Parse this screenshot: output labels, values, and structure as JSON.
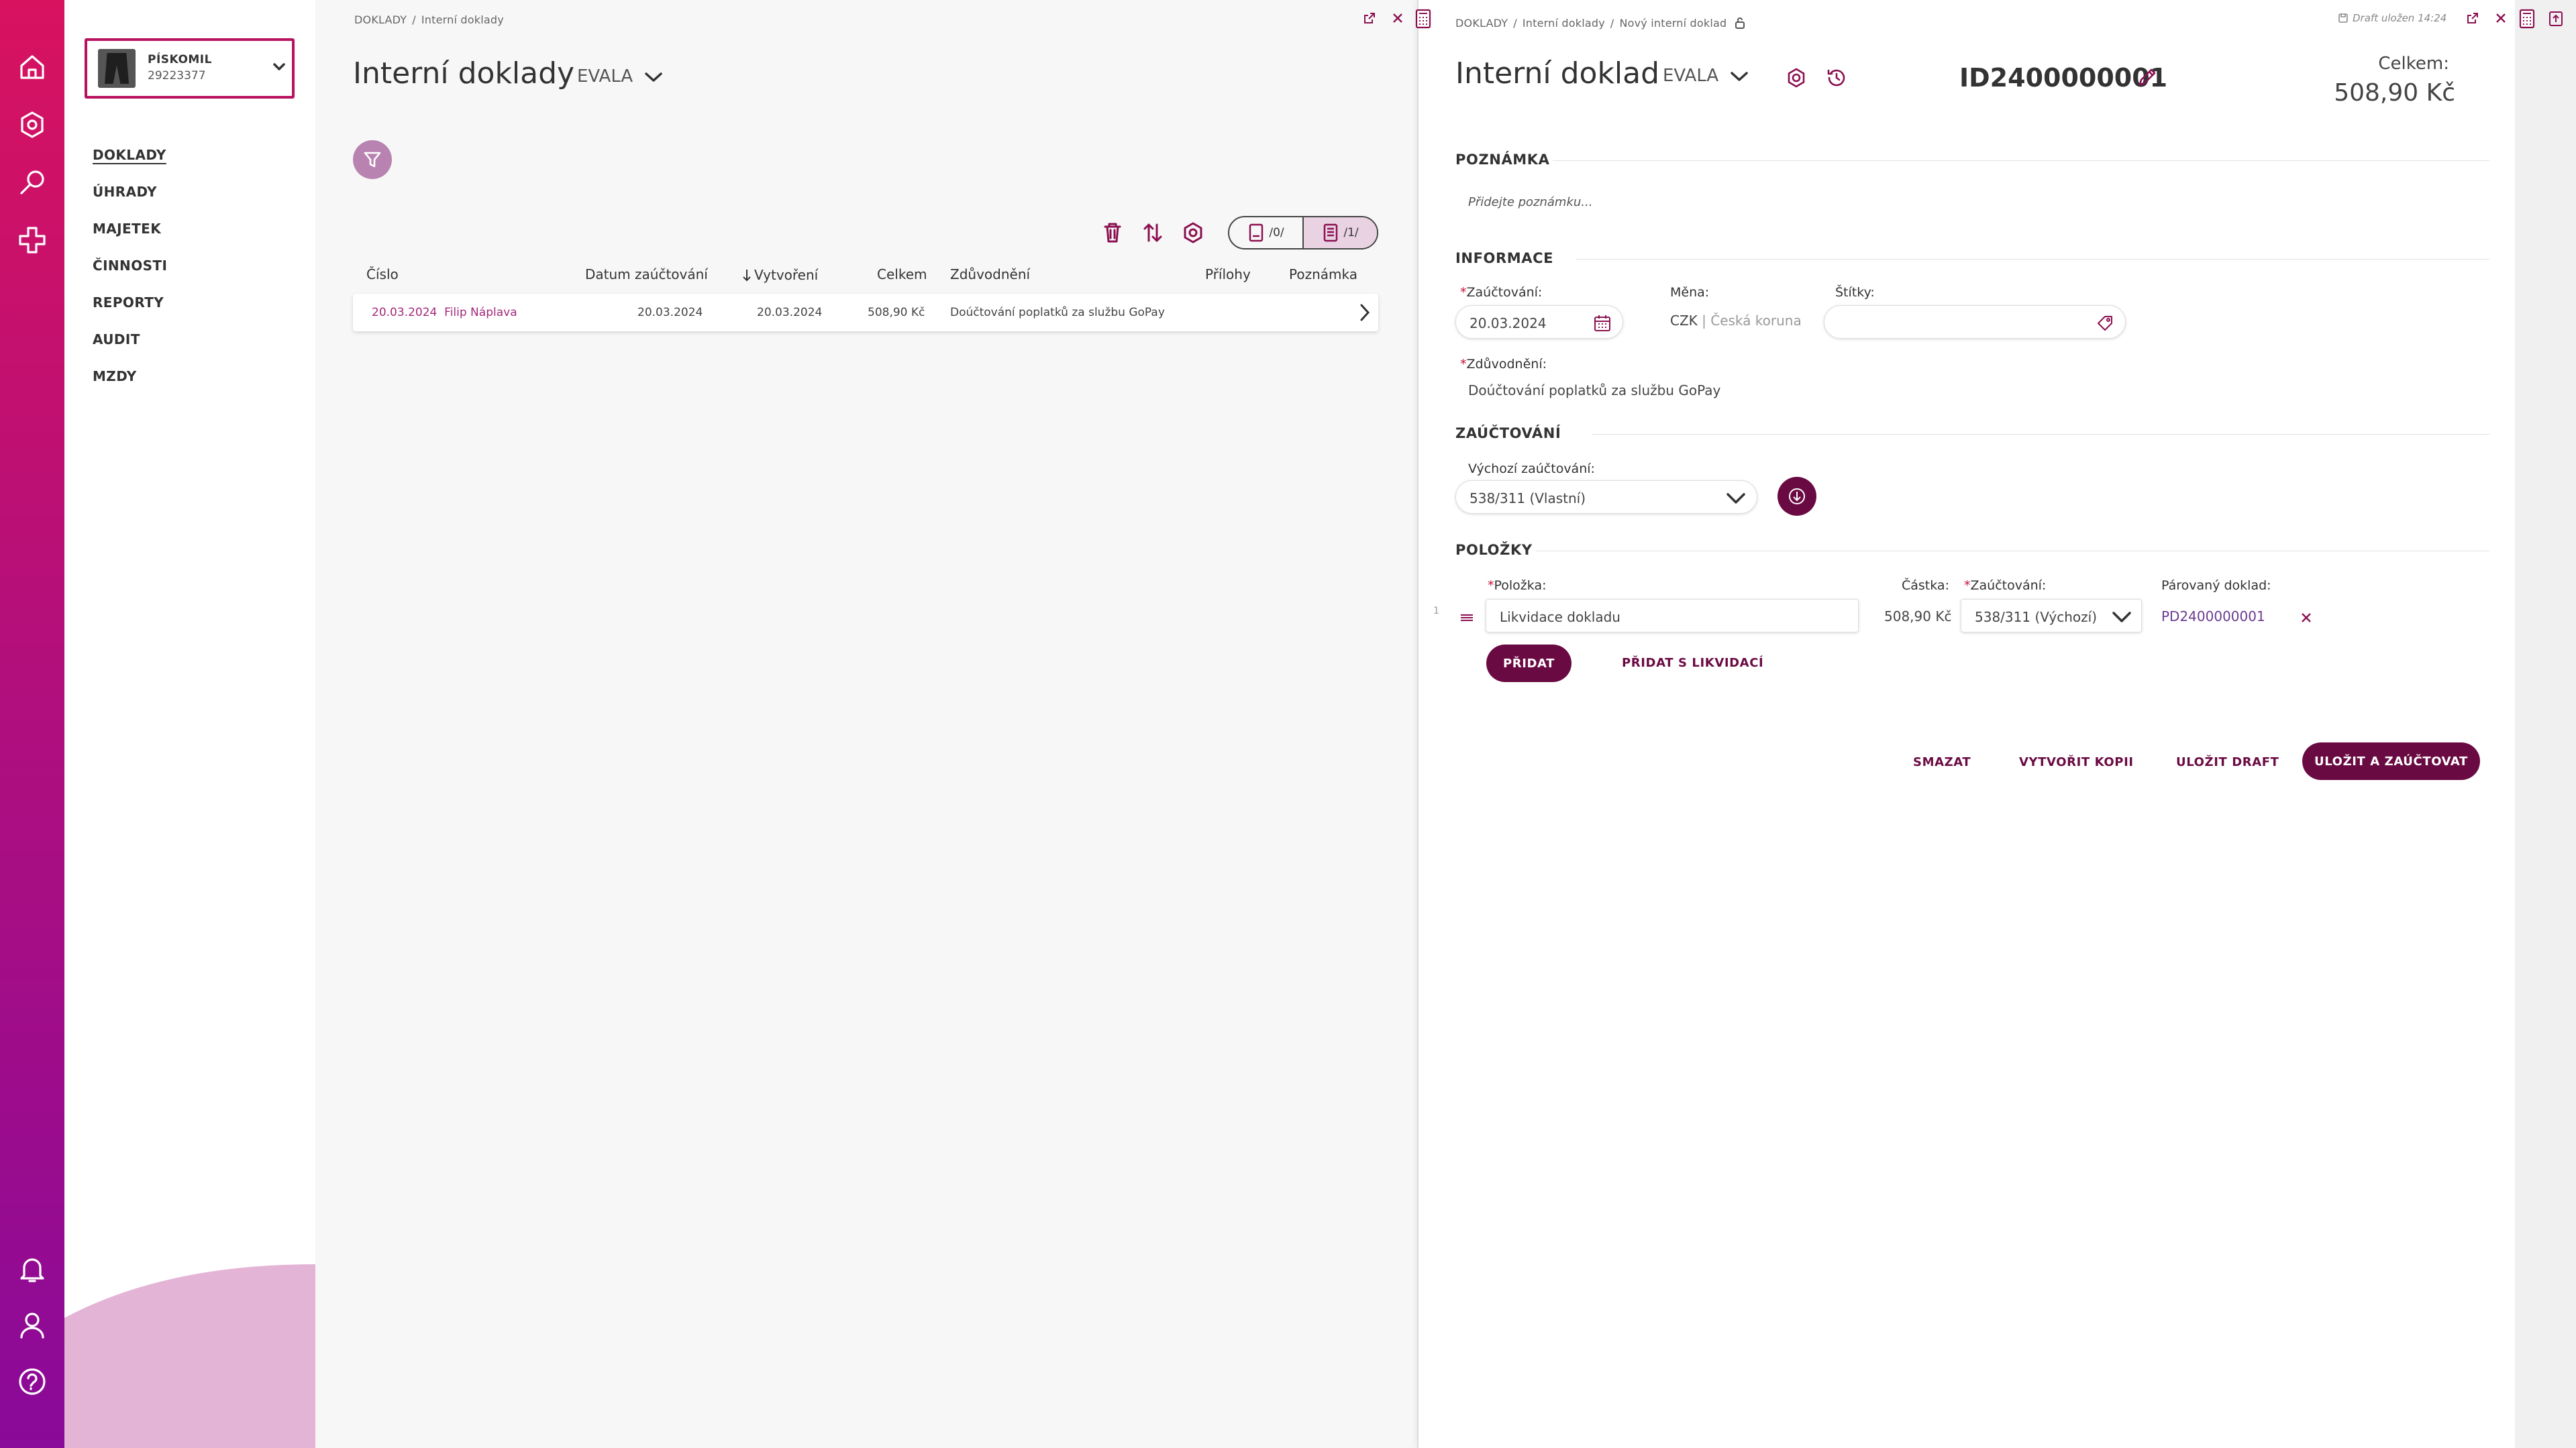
{
  "rail": {
    "top_icons": [
      "home-icon",
      "compass-icon",
      "search-icon",
      "plus-icon"
    ],
    "bottom_icons": [
      "bell-icon",
      "user-icon",
      "help-icon"
    ]
  },
  "company": {
    "name": "PÍSKOMIL",
    "id": "29223377"
  },
  "nav": {
    "items": [
      "DOKLADY",
      "ÚHRADY",
      "MAJETEK",
      "ČINNOSTI",
      "REPORTY",
      "AUDIT",
      "MZDY"
    ],
    "active": "DOKLADY"
  },
  "list": {
    "breadcrumb": [
      "DOKLADY",
      "Interní doklady"
    ],
    "title": "Interní doklady",
    "scope": "EVALA",
    "segments": [
      "/0/",
      "/1/"
    ],
    "columns": {
      "number": "Číslo",
      "posting_date": "Datum zaúčtování",
      "created": "Vytvoření",
      "total": "Celkem",
      "reason": "Zdůvodnění",
      "attachments": "Přílohy",
      "note": "Poznámka"
    },
    "rows": [
      {
        "date": "20.03.2024",
        "user": "Filip Náplava",
        "posting_date": "20.03.2024",
        "created": "20.03.2024",
        "total": "508,90 Kč",
        "reason": "Doúčtování poplatků za službu GoPay"
      }
    ]
  },
  "detail": {
    "breadcrumb": [
      "DOKLADY",
      "Interní doklady",
      "Nový interní doklad"
    ],
    "draft_status": "Draft uložen 14:24",
    "title": "Interní doklad",
    "scope": "EVALA",
    "doc_id": "ID2400000001",
    "total_label": "Celkem:",
    "total_value": "508,90 Kč",
    "note_section": "POZNÁMKA",
    "note_placeholder": "Přidejte poznámku...",
    "info_section": "INFORMACE",
    "posting_label": "Zaúčtování:",
    "posting_date": "20.03.2024",
    "currency_label": "Měna:",
    "currency_code": "CZK",
    "currency_name": "Česká koruna",
    "tags_label": "Štítky:",
    "reason_label": "Zdůvodnění:",
    "reason_value": "Doúčtování poplatků za službu GoPay",
    "accounting_section": "ZAÚČTOVÁNÍ",
    "default_posting_label": "Výchozí zaúčtování:",
    "default_posting_value": "538/311 (Vlastní)",
    "items_section": "POLOŽKY",
    "item_label": "Položka:",
    "amount_label": "Částka:",
    "item_posting_label": "Zaúčtování:",
    "paired_label": "Párovaný doklad:",
    "items": [
      {
        "index": "1",
        "name": "Likvidace dokladu",
        "amount": "508,90 Kč",
        "posting": "538/311 (Výchozí)",
        "paired": "PD2400000001"
      }
    ],
    "add_button": "PŘIDAT",
    "add_liquidation_button": "PŘIDAT S LIKVIDACÍ",
    "actions": {
      "delete": "SMAZAT",
      "copy": "VYTVOŘIT KOPII",
      "save_draft": "ULOŽIT DRAFT",
      "save_post": "ULOŽIT A ZAÚČTOVAT"
    }
  },
  "colors": {
    "brand_dark": "#6a0a42",
    "accent_pink": "#b8125f",
    "link": "#a3287a",
    "rail_top": "#d8125f",
    "rail_bottom": "#8a0a99"
  }
}
